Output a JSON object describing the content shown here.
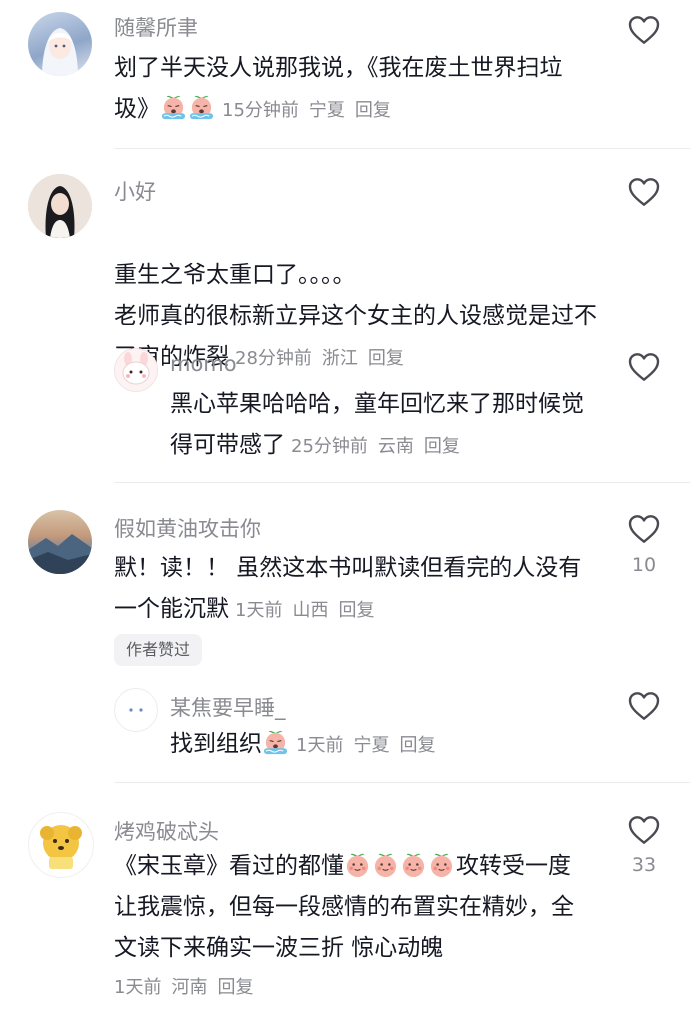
{
  "comments": [
    {
      "username": "随馨所聿",
      "text": "划了半天没人说那我说，《我在废土世界扫垃圾》",
      "emojis": [
        "crying-peach-emoji",
        "crying-peach-emoji"
      ],
      "time": "15分钟前",
      "location": "宁夏",
      "reply_label": "回复"
    },
    {
      "username": "小好",
      "text": "重生之爷太重口了。。。。\n老师真的很标新立异这个女主的人设感觉是过不了审的炸裂",
      "time": "28分钟前",
      "location": "浙江",
      "reply_label": "回复",
      "reply": {
        "username": "momo",
        "text": "黑心苹果哈哈哈，童年回忆来了那时候觉得可带感了",
        "time": "25分钟前",
        "location": "云南",
        "reply_label": "回复"
      }
    },
    {
      "username": "假如黄油攻击你",
      "text": "默！读！！ 虽然这本书叫默读但看完的人没有一个能沉默",
      "time": "1天前",
      "location": "山西",
      "reply_label": "回复",
      "like_count": "10",
      "author_badge": "作者赞过",
      "reply": {
        "username": "某焦要早睡_",
        "text": "找到组织",
        "emojis": [
          "crying-peach-emoji"
        ],
        "time": "1天前",
        "location": "宁夏",
        "reply_label": "回复"
      }
    },
    {
      "username": "烤鸡破忒头",
      "text_before": "《宋玉章》看过的都懂",
      "emojis": [
        "peach-emoji",
        "peach-emoji",
        "peach-emoji",
        "peach-emoji"
      ],
      "text_after": "攻转受一度让我震惊，但每一段感情的布置实在精妙，全文读下来确实一波三折 惊心动魄",
      "time": "1天前",
      "location": "河南",
      "reply_label": "回复",
      "like_count": "33"
    }
  ],
  "colors": {
    "primary_text": "#161823",
    "secondary_text": "#8a8b91",
    "divider": "#ececee"
  }
}
